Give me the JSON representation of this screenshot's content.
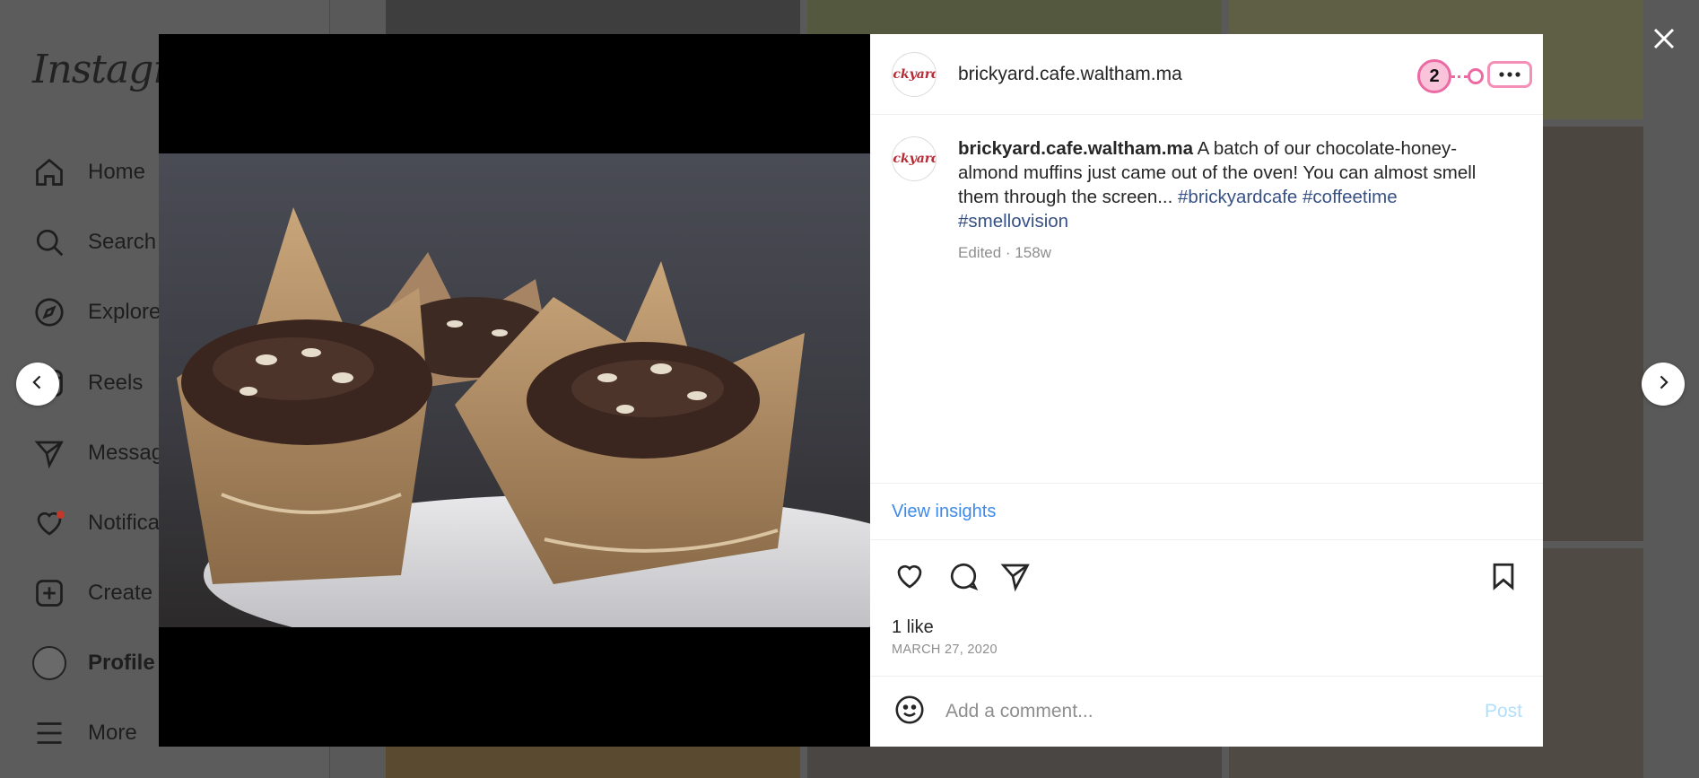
{
  "background": {
    "logo": "Instagram",
    "nav": [
      {
        "label": "Home",
        "icon": "home-icon"
      },
      {
        "label": "Search",
        "icon": "search-icon"
      },
      {
        "label": "Explore",
        "icon": "compass-icon"
      },
      {
        "label": "Reels",
        "icon": "reels-icon"
      },
      {
        "label": "Messages",
        "icon": "paper-plane-icon"
      },
      {
        "label": "Notifications",
        "icon": "heart-icon"
      },
      {
        "label": "Create",
        "icon": "plus-square-icon"
      },
      {
        "label": "Profile",
        "icon": "avatar-icon"
      },
      {
        "label": "More",
        "icon": "menu-icon"
      }
    ]
  },
  "post": {
    "username": "brickyard.cafe.waltham.ma",
    "avatar_text": "ickyard",
    "caption_username": "brickyard.cafe.waltham.ma",
    "caption_text": "A batch of our chocolate-honey-almond muffins just came out of the oven! You can almost smell them through the screen...",
    "hashtags": [
      "#brickyardcafe",
      "#coffeetime",
      "#smellovision"
    ],
    "meta": "Edited · 158w",
    "insights_label": "View insights",
    "likes": "1 like",
    "date": "MARCH 27, 2020",
    "comment_placeholder": "Add a comment...",
    "post_label": "Post",
    "annotation_badge": "2"
  },
  "colors": {
    "link": "#3f8ae8",
    "hashtag": "#385185",
    "post_disabled": "#b2dffc",
    "annotation": "#ec6aa3",
    "avatar_text": "#b52a35"
  }
}
